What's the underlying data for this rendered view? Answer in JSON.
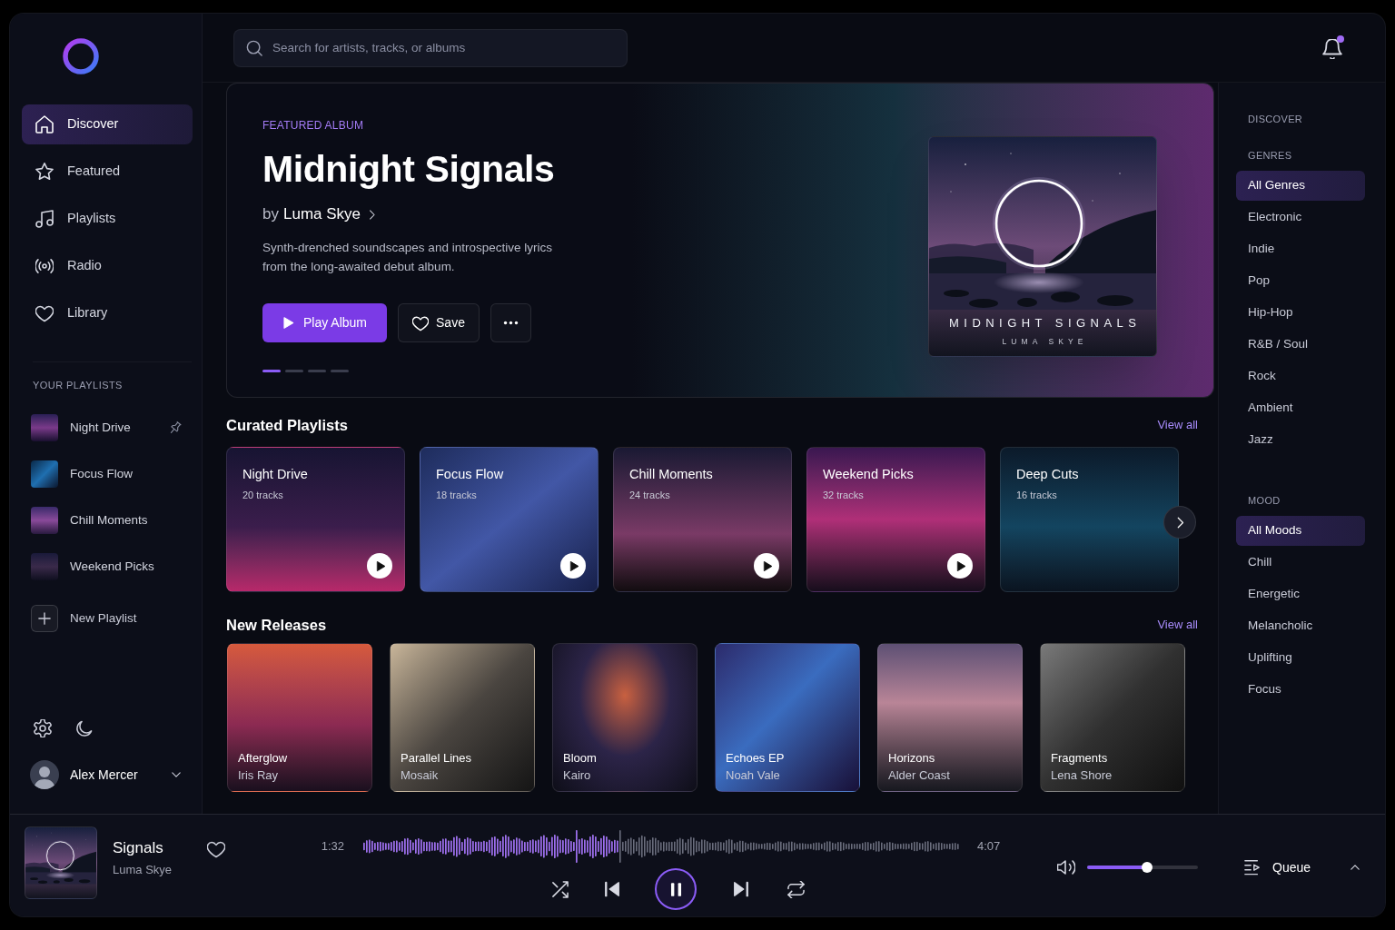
{
  "sidebar": {
    "nav": [
      {
        "label": "Discover",
        "selected": true
      },
      {
        "label": "Featured",
        "selected": false
      },
      {
        "label": "Playlists",
        "selected": false
      },
      {
        "label": "Radio",
        "selected": false
      },
      {
        "label": "Library",
        "selected": false
      }
    ],
    "playlists_heading": "YOUR PLAYLISTS",
    "playlists": [
      {
        "name": "Night Drive",
        "pinned": true,
        "selected": false
      },
      {
        "name": "Focus Flow",
        "pinned": false,
        "selected": false
      },
      {
        "name": "Chill Moments",
        "pinned": false,
        "selected": false
      },
      {
        "name": "Weekend Picks",
        "pinned": false,
        "selected": false
      }
    ],
    "new_playlist": "New Playlist",
    "user": {
      "name": "Alex Mercer"
    }
  },
  "search": {
    "placeholder": "Search for artists, tracks, or albums"
  },
  "notifications": {
    "unread": true
  },
  "hero": {
    "eyebrow": "FEATURED ALBUM",
    "title": "Midnight Signals",
    "byline_prefix": "by",
    "artist": "Luma Skye",
    "description": "Synth-drenched soundscapes and introspective lyrics from the long-awaited debut album.",
    "cover_title": "MIDNIGHT SIGNALS",
    "cover_artist": "LUMA SKYE",
    "buttons": [
      {
        "kind": "primary",
        "label": "Play Album"
      },
      {
        "kind": "secondary",
        "label": "Save"
      },
      {
        "kind": "more"
      }
    ],
    "slides": [
      {
        "selected": true
      },
      {
        "selected": false
      },
      {
        "selected": false
      },
      {
        "selected": false
      }
    ]
  },
  "curated": {
    "title": "Curated Playlists",
    "view_all": "View all",
    "cards": [
      {
        "title": "Night Drive",
        "tracks": "20 tracks",
        "play_button": true
      },
      {
        "title": "Focus Flow",
        "tracks": "18 tracks",
        "play_button": true
      },
      {
        "title": "Chill Moments",
        "tracks": "24 tracks",
        "play_button": true
      },
      {
        "title": "Weekend Picks",
        "tracks": "32 tracks",
        "play_button": true
      },
      {
        "title": "Deep Cuts",
        "tracks": "16 tracks",
        "play_button": false
      }
    ]
  },
  "new_releases": {
    "title": "New Releases",
    "view_all": "View all",
    "albums": [
      {
        "title": "Afterglow",
        "artist": "Iris Ray"
      },
      {
        "title": "Parallel Lines",
        "artist": "Mosaik"
      },
      {
        "title": "Bloom",
        "artist": "Kairo"
      },
      {
        "title": "Echoes EP",
        "artist": "Noah Vale"
      },
      {
        "title": "Horizons",
        "artist": "Alder Coast"
      },
      {
        "title": "Fragments",
        "artist": "Lena Shore"
      }
    ]
  },
  "filters": {
    "heading": "DISCOVER",
    "groups": [
      {
        "title": "GENRES",
        "items": [
          {
            "label": "All Genres",
            "selected": true
          },
          {
            "label": "Electronic",
            "selected": false
          },
          {
            "label": "Indie",
            "selected": false
          },
          {
            "label": "Pop",
            "selected": false
          },
          {
            "label": "Hip-Hop",
            "selected": false
          },
          {
            "label": "R&B / Soul",
            "selected": false
          },
          {
            "label": "Rock",
            "selected": false
          },
          {
            "label": "Ambient",
            "selected": false
          },
          {
            "label": "Jazz",
            "selected": false
          }
        ]
      },
      {
        "title": "MOOD",
        "items": [
          {
            "label": "All Moods",
            "selected": true
          },
          {
            "label": "Chill",
            "selected": false
          },
          {
            "label": "Energetic",
            "selected": false
          },
          {
            "label": "Melancholic",
            "selected": false
          },
          {
            "label": "Uplifting",
            "selected": false
          },
          {
            "label": "Focus",
            "selected": false
          }
        ]
      }
    ]
  },
  "player": {
    "title": "Signals",
    "artist": "Luma Skye",
    "liked": false,
    "elapsed": "1:32",
    "duration": "4:07",
    "progress": {
      "level": 0.43
    },
    "playing": true,
    "volume": {
      "level": 0.54
    },
    "queue_label": "Queue"
  }
}
